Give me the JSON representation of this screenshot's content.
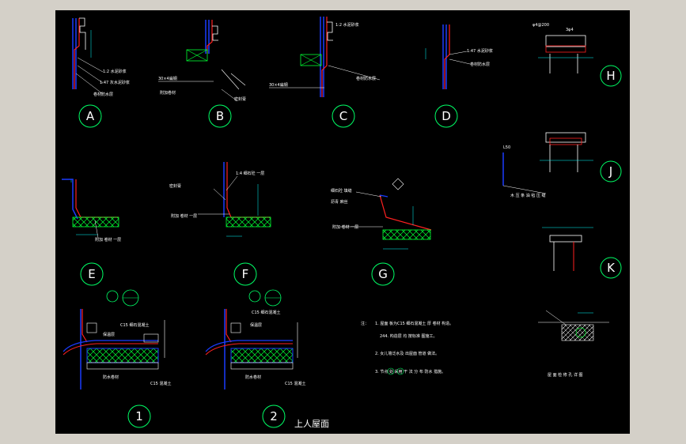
{
  "colors": {
    "background": "#000000",
    "frame": "#d4d0c8",
    "wall": "#1a3cff",
    "membrane": "#ff2020",
    "dim": "#00ffff",
    "bubble": "#00ff66",
    "insulation": "#00ff33",
    "text": "#ffffff",
    "hatch": "#ffffff"
  },
  "details": {
    "A": "A",
    "B": "B",
    "C": "C",
    "D": "D",
    "E": "E",
    "F": "F",
    "G": "G",
    "H": "H",
    "J": "J",
    "K": "K",
    "one": "1",
    "two": "2"
  },
  "labels": {
    "a_note1": "1:2 水泥砂浆",
    "a_note2": "1:47 灰水泥砂浆",
    "a_note3": "卷材防水层",
    "b_note1": "30×4扁钢",
    "b_note2": "附加卷材",
    "b_note3": "密封膏",
    "c_note1": "1:2 水泥砂浆",
    "c_note2": "卷材防水层",
    "c_note3": "30×4扁钢",
    "d_note1": "1:47 水泥砂浆",
    "d_note2": "卷材防水层",
    "e_note": "附加 卷材 一层",
    "f_note1": "1:4 细石砼 一层",
    "f_note2": "附加 卷材 一层",
    "f_note3": "密封膏",
    "g_note1": "细石砼 填缝",
    "g_note2": "沥青 麻丝",
    "g_note3": "附加 卷材 一层",
    "j_note": "木 压 条 油 毡 压 缝",
    "j_dim": "L50",
    "h_dim1": "φ4@200",
    "h_dim2": "3φ4",
    "bottom_note": "屋 面 检 修 孔 详 图",
    "one_note1": "C15 细石混凝土",
    "one_note2": "保温层",
    "one_note3": "C15 混凝土",
    "one_note4": "防水卷材",
    "two_note1": "C15 细石混凝土",
    "two_note2": "保温层",
    "two_note3": "C15 混凝土",
    "two_note4": "防水卷材"
  },
  "notes": {
    "head": "注：",
    "n1": "1. 屋面 板为C15 细石混凝土 厚 卷材 构造。",
    "n1b": "244. 构造层 均 按标准 图施工。",
    "n2": "2. 女儿墙泛水及 出屋面 管道 做法。",
    "n3": "3. 节点 处 采用 干 法 分 布 防水 措施。"
  },
  "title": "上人屋面"
}
